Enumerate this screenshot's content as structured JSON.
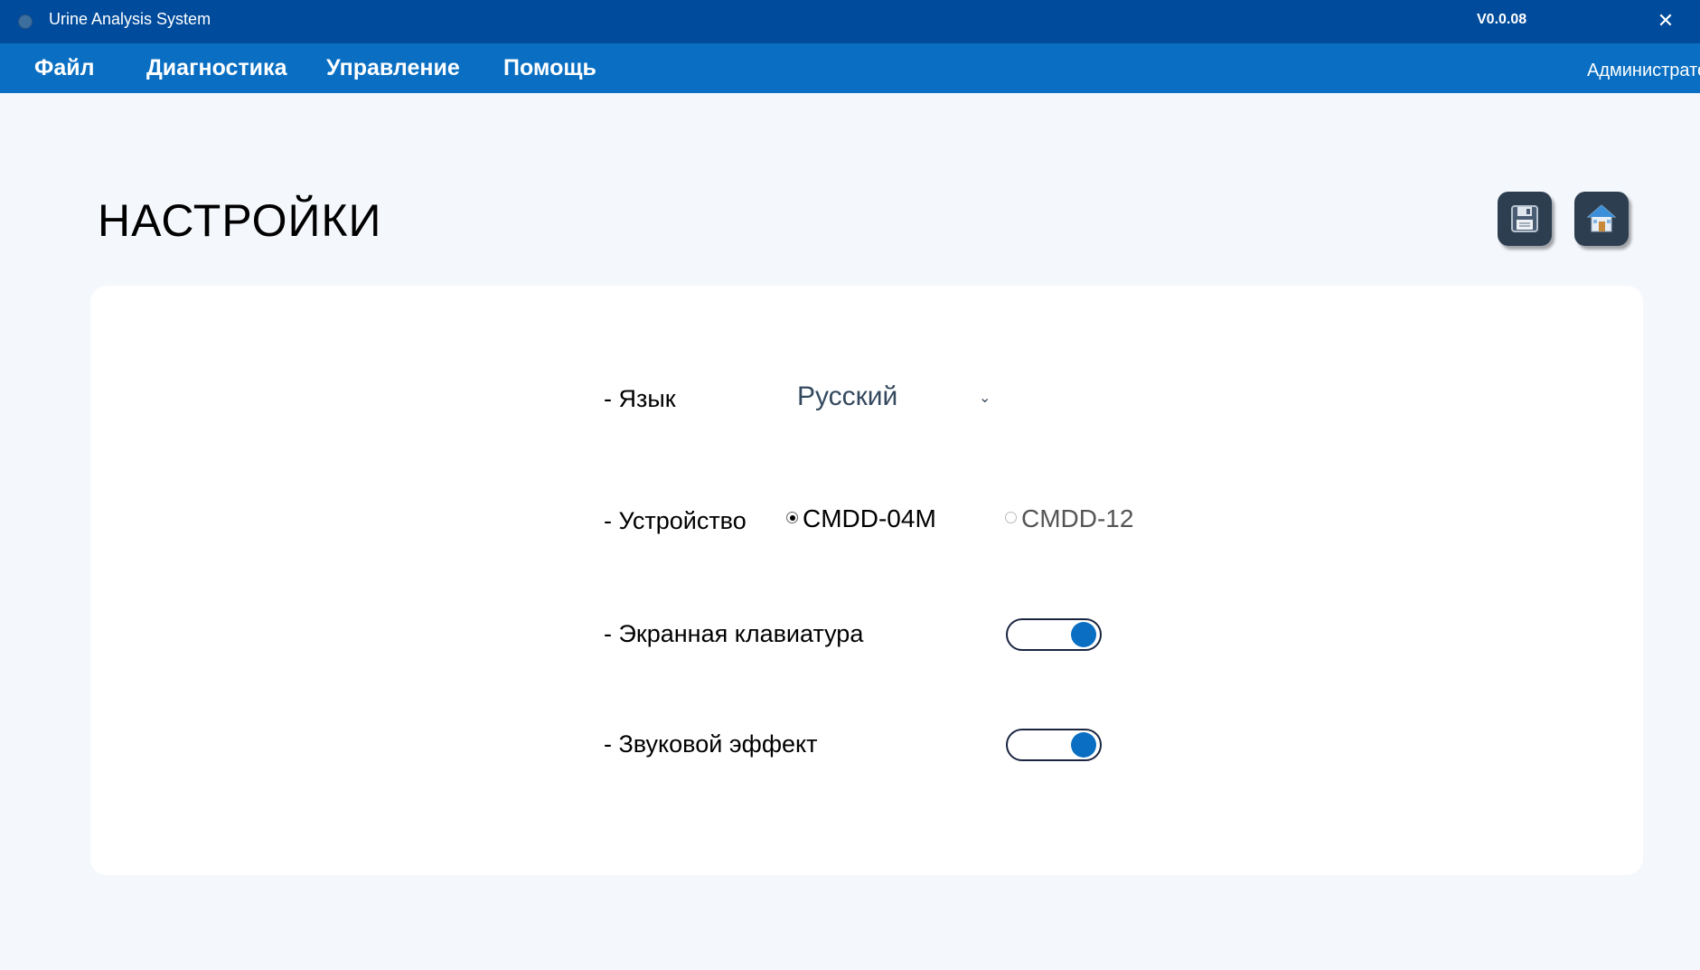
{
  "window": {
    "title": "Urine Analysis System",
    "version": "V0.0.08",
    "close_glyph": "✕"
  },
  "menu": {
    "items": [
      "Файл",
      "Диагностика",
      "Управление",
      "Помощь"
    ],
    "user": "Администратор"
  },
  "page": {
    "title": "НАСТРОЙКИ",
    "actions": [
      {
        "icon": "floppy-disk-icon"
      },
      {
        "icon": "home-icon"
      }
    ]
  },
  "settings": {
    "language": {
      "label": "- Язык",
      "value": "Русский",
      "chevron": "⌄"
    },
    "device": {
      "label": "- Устройство",
      "options": [
        "CMDD-04M",
        "CMDD-12"
      ],
      "selected": "CMDD-04M"
    },
    "onscreen_keyboard": {
      "label": "- Экранная клавиатура",
      "enabled": true
    },
    "sound_effect": {
      "label": "- Звуковой эффект",
      "enabled": true
    }
  },
  "colors": {
    "titlebar": "#004b9c",
    "menubar": "#0a6fc2",
    "accent": "#0a6fc2",
    "page_bg": "#f4f7fc"
  }
}
